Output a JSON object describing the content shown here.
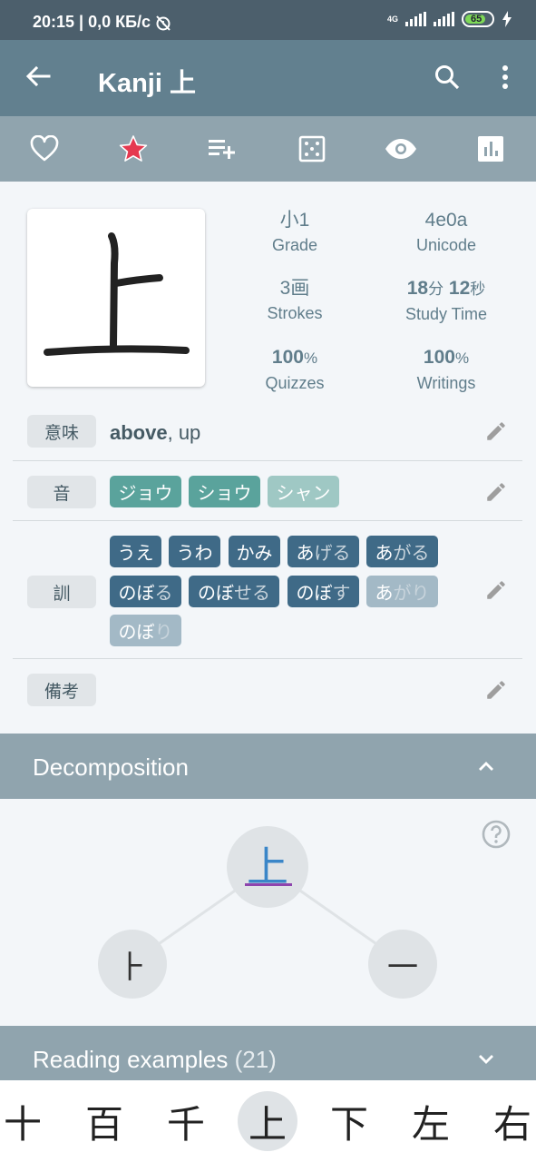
{
  "status": {
    "time_speed": "20:15 | 0,0 КБ/с",
    "net_type": "4G",
    "battery": "65"
  },
  "appbar": {
    "title": "Kanji 上"
  },
  "toolbar": {
    "icons": [
      "heart-outline-icon",
      "star-icon",
      "playlist-add-icon",
      "dice-icon",
      "eye-icon",
      "bar-chart-icon"
    ],
    "star_color": "#e53950"
  },
  "kanji": {
    "character": "上"
  },
  "stats": {
    "grade": {
      "value": "小1",
      "label": "Grade"
    },
    "unicode": {
      "value": "4e0a",
      "label": "Unicode"
    },
    "strokes": {
      "value": "3画",
      "label": "Strokes"
    },
    "study": {
      "min": "18",
      "min_unit": "分",
      "sec": "12",
      "sec_unit": "秒",
      "label": "Study Time"
    },
    "quizzes": {
      "value": "100",
      "unit": "%",
      "label": "Quizzes"
    },
    "writings": {
      "value": "100",
      "unit": "%",
      "label": "Writings"
    }
  },
  "meaning": {
    "label": "意味",
    "primary": "above",
    "rest": ", up"
  },
  "on": {
    "label": "音",
    "readings": [
      "ジョウ",
      "ショウ",
      "シャン"
    ]
  },
  "kun": {
    "label": "訓",
    "readings": [
      {
        "stem": "うえ",
        "okurigana": ""
      },
      {
        "stem": "うわ",
        "okurigana": ""
      },
      {
        "stem": "かみ",
        "okurigana": ""
      },
      {
        "stem": "あ",
        "okurigana": "げる"
      },
      {
        "stem": "あ",
        "okurigana": "がる"
      },
      {
        "stem": "のぼ",
        "okurigana": "る"
      },
      {
        "stem": "のぼ",
        "okurigana": "せる"
      },
      {
        "stem": "のぼ",
        "okurigana": "す"
      },
      {
        "stem": "あ",
        "okurigana": "がり"
      },
      {
        "stem": "のぼ",
        "okurigana": "り"
      }
    ]
  },
  "notes": {
    "label": "備考"
  },
  "decomposition": {
    "title": "Decomposition",
    "root": "上",
    "children": [
      "⺊",
      "一"
    ]
  },
  "reading_examples": {
    "title": "Reading examples",
    "count": "(21)"
  },
  "bottom_nav": {
    "kanji": [
      "十",
      "百",
      "千",
      "上",
      "下",
      "左",
      "右"
    ],
    "selected": "上"
  },
  "colors": {
    "appbar": "#62808f",
    "toolbar": "#90a4ae",
    "on_chip": "#5aa39c",
    "kun_chip": "#3f6a87"
  }
}
